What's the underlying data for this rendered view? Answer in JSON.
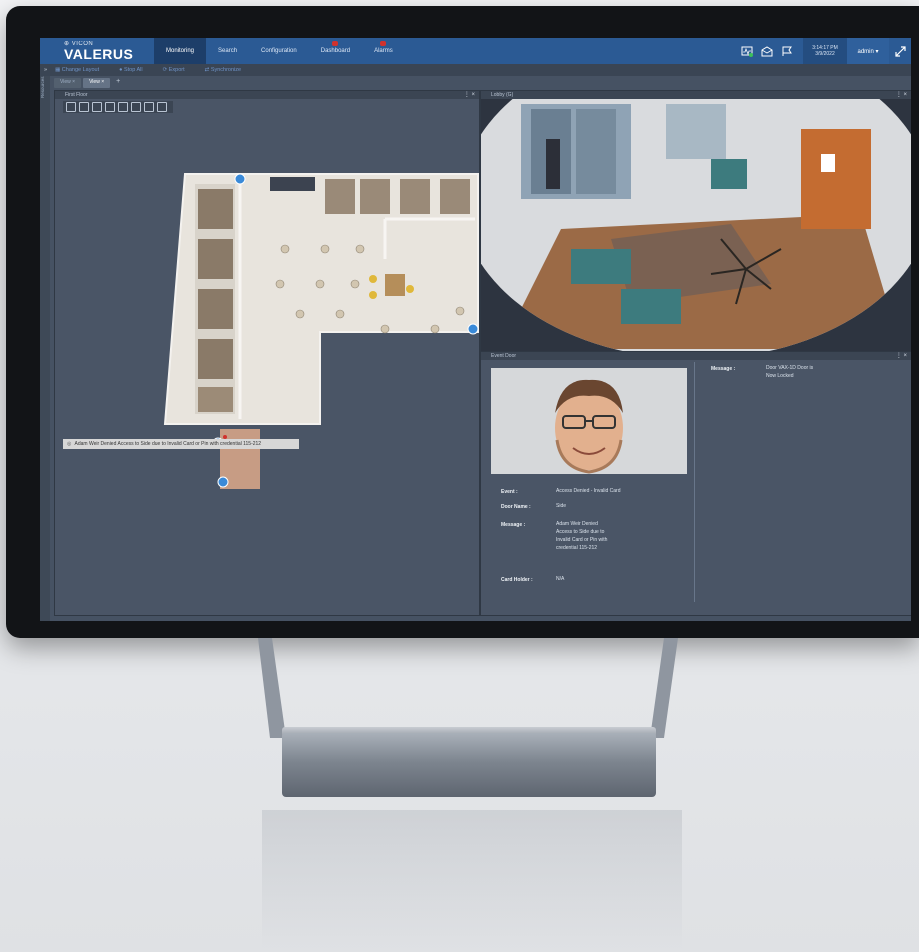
{
  "brand": {
    "small": "⊕ VICON",
    "big": "VALERUS"
  },
  "nav": [
    {
      "label": "Monitoring",
      "active": true,
      "badge": false
    },
    {
      "label": "Search",
      "active": false,
      "badge": false
    },
    {
      "label": "Configuration",
      "active": false,
      "badge": false
    },
    {
      "label": "Dashboard",
      "active": false,
      "badge": true
    },
    {
      "label": "Alarms",
      "active": false,
      "badge": true
    }
  ],
  "clock": {
    "time": "3:14:17 PM",
    "date": "3/9/2022"
  },
  "admin": "admin ▾",
  "toolbar": [
    "Change Layout",
    "Stop All",
    "Export",
    "Synchronize"
  ],
  "view_tabs": [
    "View",
    "View"
  ],
  "resources_label": "Resources",
  "floor_panel": {
    "title": "First Floor"
  },
  "lobby_panel": {
    "title": "Lobby (G)"
  },
  "event_panel": {
    "title": "Event Door"
  },
  "alert_text": "Adam Weir Denied Access to Side due to Invalid Card or Pin with credential 115-212",
  "event": {
    "event_label": "Event :",
    "event_value": "Access Denied - Invalid Card",
    "door_label": "Door Name :",
    "door_value": "Side",
    "message_label": "Message :",
    "message_value": "Adam Weir Denied Access to Side due to Invalid Card or Pin with credential 115-212",
    "card_label": "Card Holder :",
    "card_value": "N/A",
    "right_message_label": "Message :",
    "right_message_value": "Door VAX-1D Door is Now Locked"
  },
  "colors": {
    "topbar": "#2b5a94",
    "screen": "#465263",
    "alert": "#d0322e"
  }
}
